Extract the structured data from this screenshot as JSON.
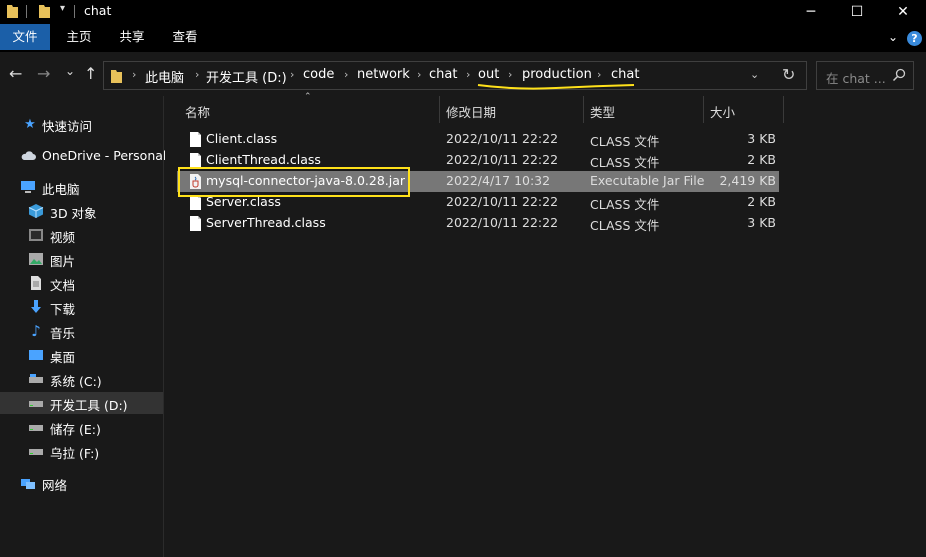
{
  "window": {
    "title": "chat",
    "minimize": "─",
    "maximize": "☐",
    "close": "✕"
  },
  "ribbon": {
    "tabs": [
      "文件",
      "主页",
      "共享",
      "查看"
    ],
    "active_tab": "文件",
    "accent_color": "#1b5fa8"
  },
  "navigation": {
    "back": "←",
    "forward": "→",
    "recent": "⌄",
    "up": "↑",
    "breadcrumb": [
      "此电脑",
      "开发工具 (D:)",
      "code",
      "network",
      "chat",
      "out",
      "production",
      "chat"
    ],
    "search_placeholder": "在 chat ..."
  },
  "sidebar": {
    "items": [
      {
        "label": "快速访问",
        "icon": "star-icon"
      },
      {
        "label": "OneDrive - Personal",
        "icon": "cloud-icon"
      },
      {
        "label": "此电脑",
        "icon": "computer-icon"
      },
      {
        "label": "3D 对象",
        "icon": "cube-icon"
      },
      {
        "label": "视频",
        "icon": "video-icon"
      },
      {
        "label": "图片",
        "icon": "picture-icon"
      },
      {
        "label": "文档",
        "icon": "document-icon"
      },
      {
        "label": "下载",
        "icon": "download-icon"
      },
      {
        "label": "音乐",
        "icon": "music-icon"
      },
      {
        "label": "桌面",
        "icon": "desktop-icon"
      },
      {
        "label": "系统 (C:)",
        "icon": "drive-icon"
      },
      {
        "label": "开发工具 (D:)",
        "icon": "drive-icon"
      },
      {
        "label": "储存 (E:)",
        "icon": "drive-icon"
      },
      {
        "label": "乌拉 (F:)",
        "icon": "drive-icon"
      },
      {
        "label": "网络",
        "icon": "network-icon"
      }
    ],
    "selected": "开发工具 (D:)"
  },
  "file_list": {
    "columns": [
      "名称",
      "修改日期",
      "类型",
      "大小"
    ],
    "rows": [
      {
        "name": "Client.class",
        "date": "2022/10/11 22:22",
        "type": "CLASS 文件",
        "size": "3 KB",
        "icon": "file-icon"
      },
      {
        "name": "ClientThread.class",
        "date": "2022/10/11 22:22",
        "type": "CLASS 文件",
        "size": "2 KB",
        "icon": "file-icon"
      },
      {
        "name": "mysql-connector-java-8.0.28.jar",
        "date": "2022/4/17 10:32",
        "type": "Executable Jar File",
        "size": "2,419 KB",
        "icon": "jar-icon"
      },
      {
        "name": "Server.class",
        "date": "2022/10/11 22:22",
        "type": "CLASS 文件",
        "size": "2 KB",
        "icon": "file-icon"
      },
      {
        "name": "ServerThread.class",
        "date": "2022/10/11 22:22",
        "type": "CLASS 文件",
        "size": "3 KB",
        "icon": "file-icon"
      }
    ],
    "selected_row": "mysql-connector-java-8.0.28.jar",
    "annotation_color": "#ffe11a"
  }
}
